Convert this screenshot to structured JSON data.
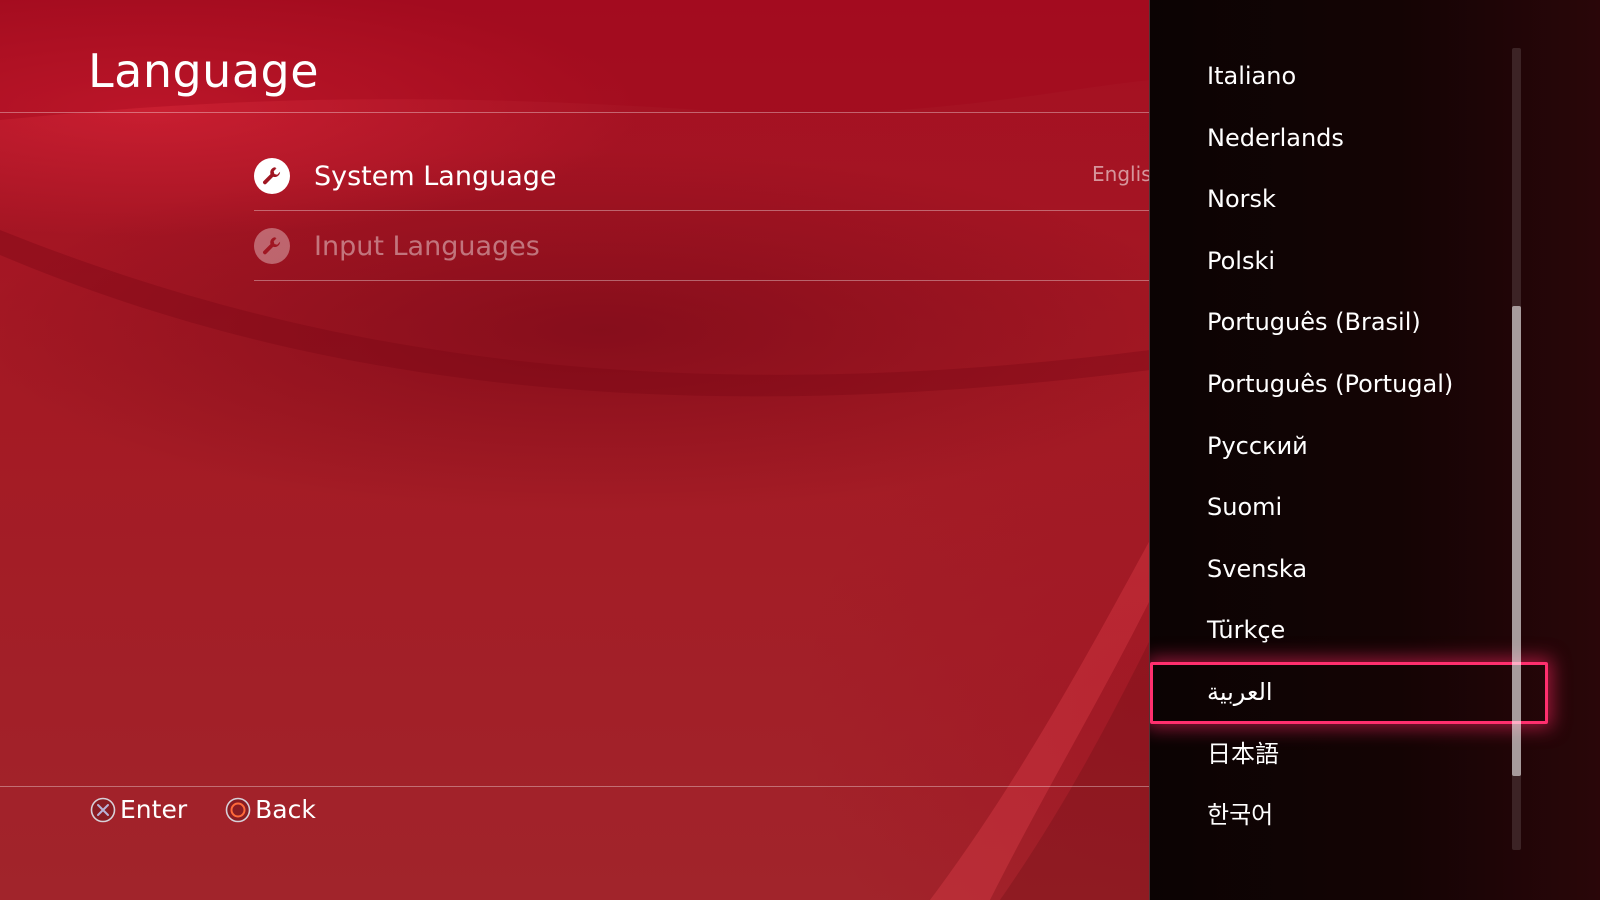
{
  "header": {
    "title": "Language"
  },
  "menu": {
    "items": [
      {
        "label": "System Language",
        "icon": "wrench-icon",
        "enabled": true
      },
      {
        "label": "Input Languages",
        "icon": "wrench-icon",
        "enabled": false
      }
    ],
    "system_language_value": "English (United Kingdom)"
  },
  "footer": {
    "enter_label": "Enter",
    "back_label": "Back",
    "enter_icon": "cross-button-icon",
    "back_icon": "circle-button-icon"
  },
  "dropdown": {
    "options": [
      "Italiano",
      "Nederlands",
      "Norsk",
      "Polski",
      "Português (Brasil)",
      "Português (Portugal)",
      "Русский",
      "Suomi",
      "Svenska",
      "Türkçe",
      "العربية",
      "日本語",
      "한국어"
    ],
    "focused_option": "العربية"
  },
  "colors": {
    "background": "#a11a23",
    "panel": "#120404",
    "focus_highlight": "#ff2f6e"
  }
}
